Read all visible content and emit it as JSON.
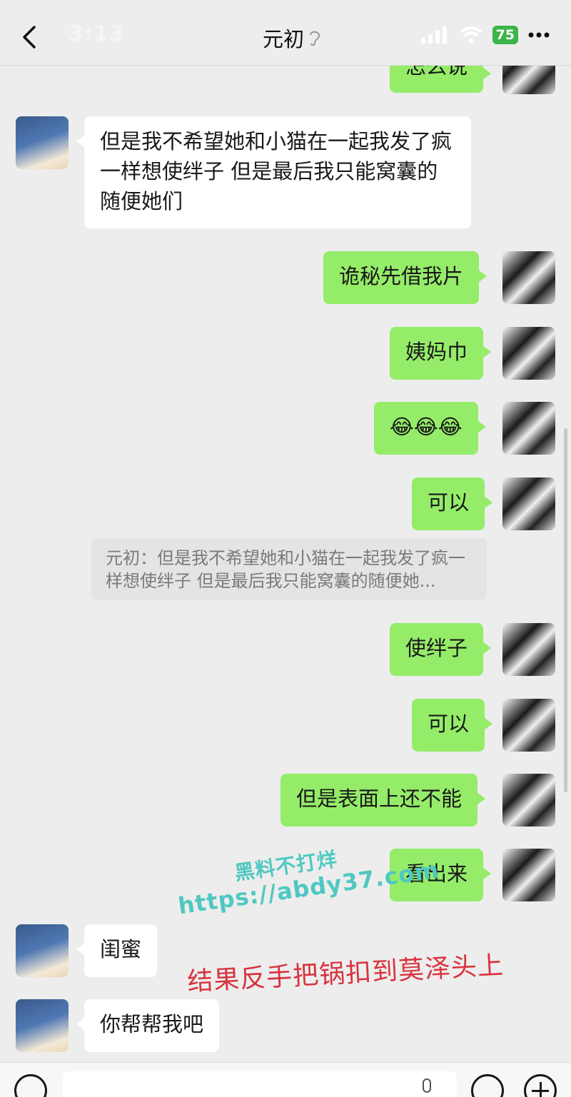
{
  "status_bar": {
    "time": "3:13",
    "battery": "75"
  },
  "header": {
    "title": "元初"
  },
  "messages": [
    {
      "side": "right",
      "text": "怎么说"
    },
    {
      "side": "left",
      "text": "但是我不希望她和小猫在一起我发了疯一样想使绊子 但是最后我只能窝囊的随便她们"
    },
    {
      "side": "right",
      "text": "诡秘先借我片"
    },
    {
      "side": "right",
      "text": "姨妈巾"
    },
    {
      "side": "right",
      "text": "😂😂😂"
    },
    {
      "side": "right",
      "text": "可以"
    },
    {
      "side": "right",
      "text": "使绊子"
    },
    {
      "side": "right",
      "text": "可以"
    },
    {
      "side": "right",
      "text": "但是表面上还不能"
    },
    {
      "side": "right",
      "text": "看出来"
    },
    {
      "side": "left",
      "text": "闺蜜"
    },
    {
      "side": "left",
      "text": "你帮帮我吧"
    }
  ],
  "quote": {
    "text": "元初：但是我不希望她和小猫在一起我发了疯一样想使绊子 但是最后我只能窝囊的随便她..."
  },
  "watermark": {
    "line1": "黑料不打烊",
    "line2": "https://abdy37.com"
  },
  "annotation": {
    "text": "结果反手把锅扣到莫泽头上"
  },
  "icons": [
    "back-chevron-icon",
    "hearing-icon",
    "signal-icon",
    "wifi-icon",
    "more-icon",
    "voice-icon",
    "mic-icon",
    "emoji-icon",
    "plus-icon"
  ],
  "colors": {
    "background": "#ededed",
    "bubble_self": "#95ec69",
    "bubble_other": "#ffffff",
    "annotation": "#d9333f",
    "watermark": "#4fc8c1"
  }
}
